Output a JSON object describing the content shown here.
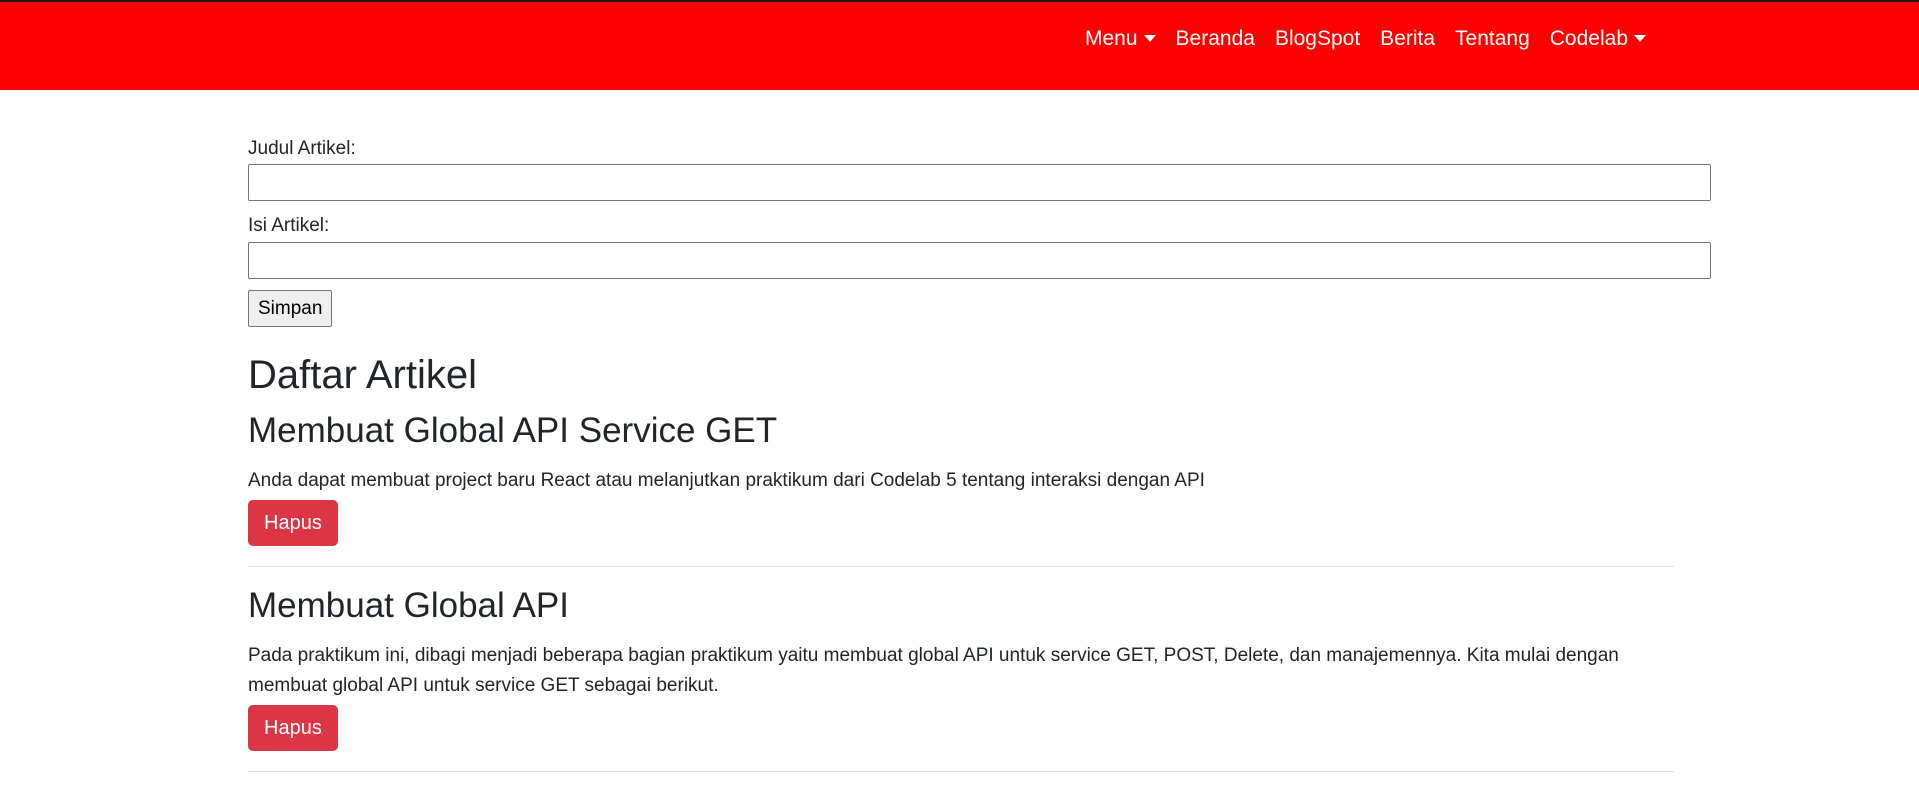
{
  "navbar": {
    "items": [
      {
        "label": "Menu",
        "dropdown": true
      },
      {
        "label": "Beranda",
        "dropdown": false
      },
      {
        "label": "BlogSpot",
        "dropdown": false
      },
      {
        "label": "Berita",
        "dropdown": false
      },
      {
        "label": "Tentang",
        "dropdown": false
      },
      {
        "label": "Codelab",
        "dropdown": true
      }
    ],
    "background_color": "#ff0000",
    "text_color": "#ffffff"
  },
  "form": {
    "title_label": "Judul Artikel:",
    "title_value": "",
    "body_label": "Isi Artikel:",
    "body_value": "",
    "submit_label": "Simpan"
  },
  "list": {
    "heading": "Daftar Artikel",
    "articles": [
      {
        "title": "Membuat Global API Service GET",
        "body": "Anda dapat membuat project baru React atau melanjutkan praktikum dari Codelab 5 tentang interaksi dengan API",
        "delete_label": "Hapus"
      },
      {
        "title": "Membuat Global API",
        "body": "Pada praktikum ini, dibagi menjadi beberapa bagian praktikum yaitu membuat global API untuk service GET, POST, Delete, dan manajemennya. Kita mulai dengan membuat global API untuk service GET sebagai berikut.",
        "delete_label": "Hapus"
      }
    ]
  },
  "colors": {
    "danger": "#dc3545",
    "divider": "#dee2e6"
  }
}
